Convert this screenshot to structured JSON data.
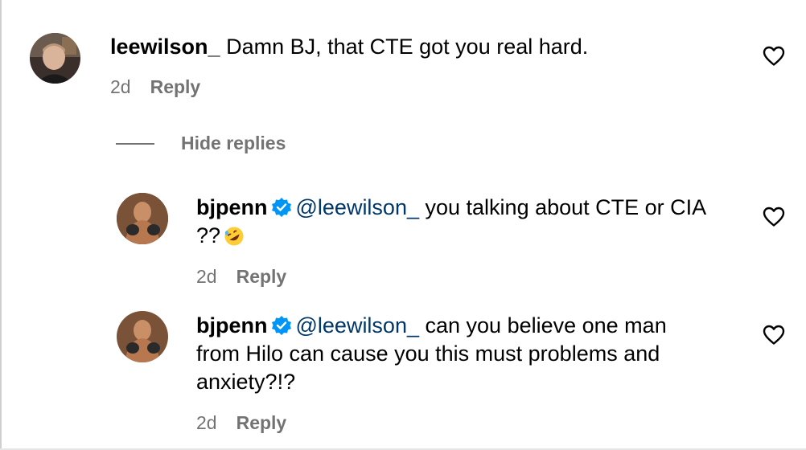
{
  "comments": [
    {
      "username": "leewilson_",
      "text": "Damn BJ, that CTE got you real hard.",
      "time": "2d",
      "reply_label": "Reply",
      "avatar_icon": "avatar-photo",
      "like_icon": "heart-outline-icon"
    }
  ],
  "hide_replies_label": "Hide replies",
  "replies": [
    {
      "username": "bjpenn",
      "verified": true,
      "mention": "@leewilson_",
      "line1": "you talking about CTE or CIA",
      "line2": "??",
      "emoji": "rolling-on-floor-laughing-emoji",
      "time": "2d",
      "reply_label": "Reply",
      "like_icon": "heart-outline-icon"
    },
    {
      "username": "bjpenn",
      "verified": true,
      "mention": "@leewilson_",
      "line1": "can you believe one man",
      "line2": "from Hilo can cause you this must problems and",
      "line3": "anxiety?!?",
      "time": "2d",
      "reply_label": "Reply",
      "like_icon": "heart-outline-icon"
    }
  ],
  "colors": {
    "text": "#000000",
    "secondary": "#737373",
    "mention": "#00376b",
    "verified": "#0095f6"
  }
}
